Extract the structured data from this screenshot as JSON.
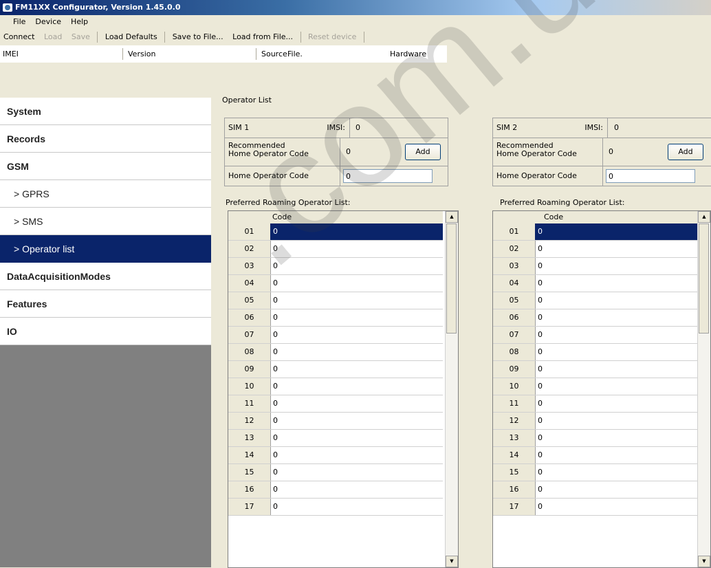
{
  "window": {
    "title": "FM11XX Configurator, Version 1.45.0.0"
  },
  "menu": [
    "File",
    "Device",
    "Help"
  ],
  "toolbar": {
    "connect": "Connect",
    "load": "Load",
    "save": "Save",
    "load_defaults": "Load Defaults",
    "save_to_file": "Save to File...",
    "load_from_file": "Load from File...",
    "reset_device": "Reset device"
  },
  "infobar": {
    "imei": "IMEI",
    "version": "Version",
    "source": "Source",
    "source_value": "File.",
    "hardware": "Hardware"
  },
  "sidebar": {
    "items": [
      {
        "label": "System"
      },
      {
        "label": "Records"
      },
      {
        "label": "GSM"
      },
      {
        "label": "> GPRS"
      },
      {
        "label": "> SMS"
      },
      {
        "label": "> Operator list"
      },
      {
        "label": "DataAcquisitionModes"
      },
      {
        "label": "Features"
      },
      {
        "label": "IO"
      }
    ],
    "selected": "> Operator list"
  },
  "main": {
    "group_title": "Operator List",
    "sims": [
      {
        "sim_label": "SIM 1",
        "imsi_label": "IMSI:",
        "imsi_value": "0",
        "recommended_label_line1": "Recommended",
        "recommended_label_line2": "Home Operator Code",
        "recommended_value": "0",
        "add_label": "Add",
        "home_label": "Home Operator Code",
        "home_value": "0",
        "roaming_label": "Preferred Roaming Operator List:",
        "column_header": "Code"
      },
      {
        "sim_label": "SIM 2",
        "imsi_label": "IMSI:",
        "imsi_value": "0",
        "recommended_label_line1": "Recommended",
        "recommended_label_line2": "Home Operator Code",
        "recommended_value": "0",
        "add_label": "Add",
        "home_label": "Home Operator Code",
        "home_value": "0",
        "roaming_label": "Preferred Roaming Operator List:",
        "column_header": "Code"
      }
    ],
    "rows": [
      {
        "n": "01",
        "code": "0"
      },
      {
        "n": "02",
        "code": "0"
      },
      {
        "n": "03",
        "code": "0"
      },
      {
        "n": "04",
        "code": "0"
      },
      {
        "n": "05",
        "code": "0"
      },
      {
        "n": "06",
        "code": "0"
      },
      {
        "n": "07",
        "code": "0"
      },
      {
        "n": "08",
        "code": "0"
      },
      {
        "n": "09",
        "code": "0"
      },
      {
        "n": "10",
        "code": "0"
      },
      {
        "n": "11",
        "code": "0"
      },
      {
        "n": "12",
        "code": "0"
      },
      {
        "n": "13",
        "code": "0"
      },
      {
        "n": "14",
        "code": "0"
      },
      {
        "n": "15",
        "code": "0"
      },
      {
        "n": "16",
        "code": "0"
      },
      {
        "n": "17",
        "code": "0"
      }
    ],
    "selected_row": "01"
  },
  "watermark": ".com.ua"
}
